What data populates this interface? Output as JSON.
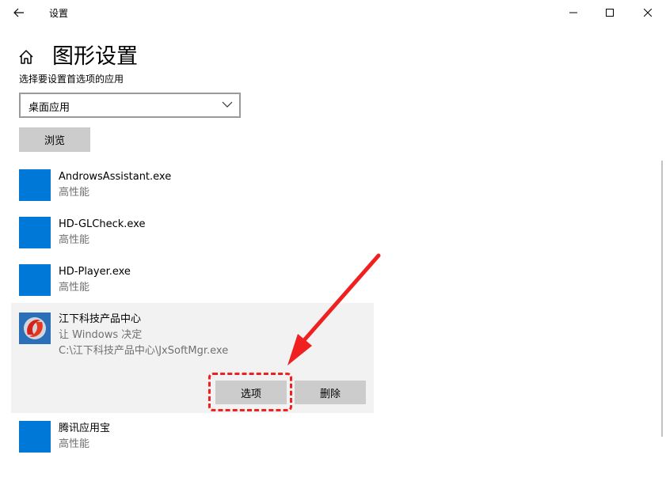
{
  "window": {
    "title": "设置",
    "back_icon": "back-arrow-icon",
    "controls": [
      "minimize-icon",
      "maximize-icon",
      "close-icon"
    ]
  },
  "header": {
    "home_icon": "home-icon",
    "page_title": "图形设置"
  },
  "app_selector": {
    "label": "选择要设置首选项的应用",
    "dropdown_value": "桌面应用",
    "browse_label": "浏览"
  },
  "apps": [
    {
      "name": "AndrowsAssistant.exe",
      "preference": "高性能"
    },
    {
      "name": "HD-GLCheck.exe",
      "preference": "高性能"
    },
    {
      "name": "HD-Player.exe",
      "preference": "高性能"
    },
    {
      "name": "江下科技产品中心",
      "preference": "让 Windows 决定",
      "path": "C:\\江下科技产品中心\\JxSoftMgr.exe",
      "selected": true,
      "options_label": "选项",
      "remove_label": "删除"
    },
    {
      "name": "腾讯应用宝",
      "preference": "高性能"
    }
  ],
  "colors": {
    "accent": "#0078d7",
    "annotation": "#f02020",
    "button_gray": "#cccccc",
    "selected_row": "#f2f2f2"
  }
}
